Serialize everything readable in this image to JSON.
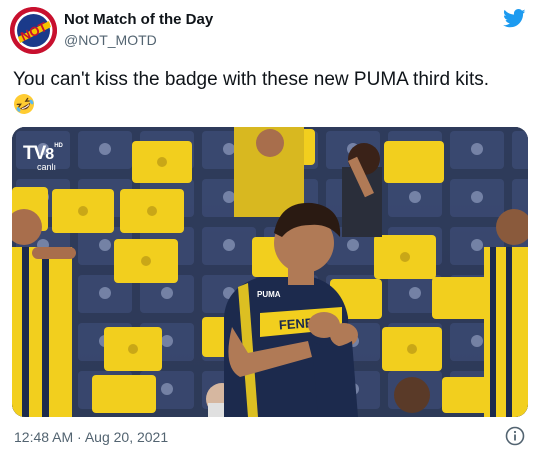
{
  "tweet": {
    "display_name": "Not Match of the Day",
    "handle": "@NOT_MOTD",
    "avatar_text": "NOT",
    "text": "You can't kiss the badge with these new PUMA third kits.",
    "emoji_icon": "rolling-on-floor-laughing-emoji",
    "timestamp": "12:48 AM · Aug 20, 2021"
  },
  "media": {
    "channel_name": "TV",
    "channel_number": "8",
    "channel_hd": "HD",
    "channel_live": "canlı",
    "shirt_brand": "PUMA",
    "shirt_sponsor": "FENER"
  },
  "icons": {
    "brand": "twitter-bird-icon",
    "info": "info-icon"
  },
  "colors": {
    "brand": "#1d9bf0",
    "seat_yellow": "#f2cf1e",
    "kit_navy": "#1c2a4d",
    "secondary_text": "#536471"
  }
}
